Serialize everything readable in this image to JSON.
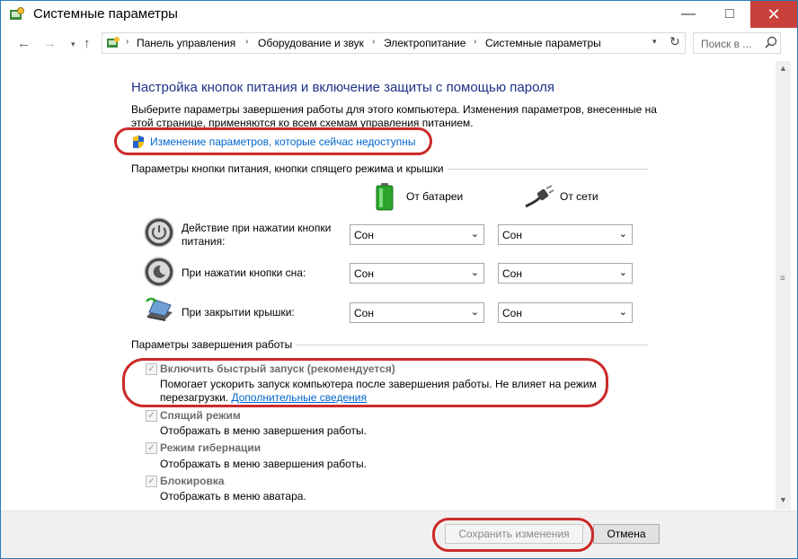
{
  "window": {
    "title": "Системные параметры",
    "min_glyph": "—",
    "max_glyph": "□",
    "close_glyph": "✕"
  },
  "nav": {
    "back_glyph": "←",
    "forward_glyph": "→",
    "recent_glyph": "▾",
    "up_glyph": "↑"
  },
  "breadcrumb": [
    "Панель управления",
    "Оборудование и звук",
    "Электропитание",
    "Системные параметры"
  ],
  "breadcrumb_sep": "›",
  "search": {
    "placeholder": "Поиск в ...",
    "icon": "search-icon"
  },
  "main": {
    "title": "Настройка кнопок питания и включение защиты с помощью пароля",
    "description": "Выберите параметры завершения работы для этого компьютера. Изменения параметров, внесенные на этой странице, применяются ко всем схемам управления питанием.",
    "change_link": "Изменение параметров, которые сейчас недоступны"
  },
  "buttons_section": {
    "title": "Параметры кнопки питания, кнопки спящего режима и крышки",
    "col_battery": "От батареи",
    "col_ac": "От сети",
    "rows": [
      {
        "label": "Действие при нажатии кнопки питания:",
        "battery": "Сон",
        "ac": "Сон"
      },
      {
        "label": "При нажатии кнопки сна:",
        "battery": "Сон",
        "ac": "Сон"
      },
      {
        "label": "При закрытии крышки:",
        "battery": "Сон",
        "ac": "Сон"
      }
    ]
  },
  "shutdown_section": {
    "title": "Параметры завершения работы",
    "fast_startup": {
      "label": "Включить быстрый запуск (рекомендуется)",
      "desc": "Помогает ускорить запуск компьютера после завершения работы. Не влияет на режим перезагрузки.",
      "link": "Дополнительные сведения",
      "checked": true
    },
    "sleep": {
      "label": "Спящий режим",
      "desc": "Отображать в меню завершения работы.",
      "checked": true
    },
    "hibernate": {
      "label": "Режим гибернации",
      "desc": "Отображать в меню завершения работы.",
      "checked": true
    },
    "lock": {
      "label": "Блокировка",
      "desc": "Отображать в меню аватара.",
      "checked": true
    }
  },
  "footer": {
    "save": "Сохранить изменения",
    "cancel": "Отмена"
  },
  "colors": {
    "title_blue": "#1e3287",
    "link": "#0066cc",
    "highlight_red": "#cc2a2a",
    "close_red": "#c8413a"
  }
}
